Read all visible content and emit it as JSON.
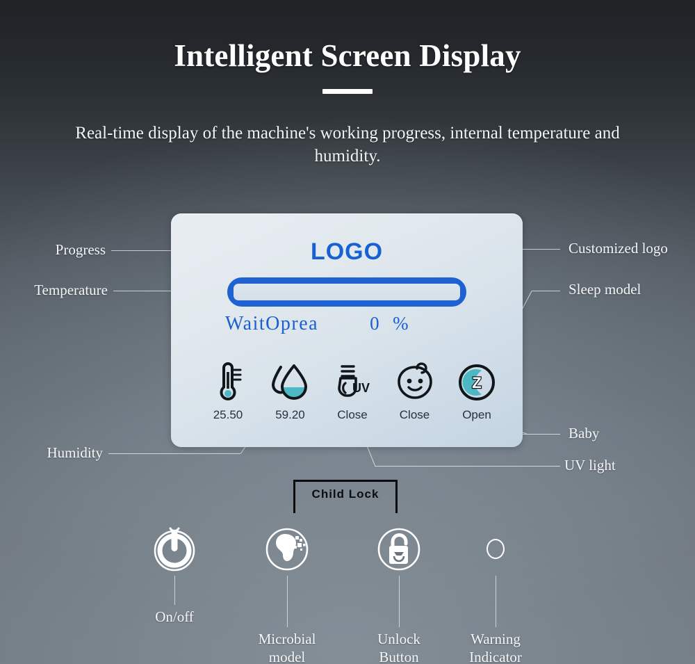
{
  "header": {
    "title": "Intelligent Screen Display",
    "subtitle": "Real-time display of the machine's working progress, internal temperature and humidity."
  },
  "colors": {
    "accent_blue": "#1d62d0",
    "logo_blue": "#1661d4",
    "icon_teal": "#4bb8c4",
    "icon_dark": "#11161a",
    "label_white": "#f4f6f7"
  },
  "panel": {
    "logo_text": "LOGO",
    "progress": {
      "percent": 0,
      "status_text": "WaitOprea",
      "percent_value": "0",
      "percent_symbol": "%"
    },
    "indicators": [
      {
        "icon": "thermometer-icon",
        "label": "25.50",
        "name": "temperature-indicator"
      },
      {
        "icon": "water-drop-icon",
        "label": "59.20",
        "name": "humidity-indicator"
      },
      {
        "icon": "uv-lamp-icon",
        "label": "Close",
        "name": "uv-light-indicator"
      },
      {
        "icon": "baby-face-icon",
        "label": "Close",
        "name": "baby-mode-indicator"
      },
      {
        "icon": "sleep-moon-icon",
        "label": "Open",
        "name": "sleep-mode-indicator"
      }
    ]
  },
  "callouts": {
    "left": [
      {
        "label": "Progress",
        "name": "callout-progress"
      },
      {
        "label": "Temperature",
        "name": "callout-temperature"
      },
      {
        "label": "Humidity",
        "name": "callout-humidity"
      }
    ],
    "right": [
      {
        "label": "Customized logo",
        "name": "callout-customized-logo"
      },
      {
        "label": "Sleep model",
        "name": "callout-sleep-model"
      },
      {
        "label": "Baby",
        "name": "callout-baby"
      },
      {
        "label": "UV light",
        "name": "callout-uv-light"
      }
    ]
  },
  "child_lock": {
    "label": "Child Lock"
  },
  "controls": [
    {
      "icon": "power-icon",
      "label": "On/off",
      "name": "on-off-button"
    },
    {
      "icon": "microbial-icon",
      "label": "Microbial\nmodel",
      "label_line1": "Microbial",
      "label_line2": "model",
      "name": "microbial-model-button"
    },
    {
      "icon": "unlock-padlock-icon",
      "label": "Unlock\nButton",
      "label_line1": "Unlock",
      "label_line2": "Button",
      "name": "unlock-button"
    },
    {
      "icon": "warning-dot-icon",
      "label": "Warning\nIndicator",
      "label_line1": "Warning",
      "label_line2": "Indicator",
      "name": "warning-indicator"
    }
  ]
}
